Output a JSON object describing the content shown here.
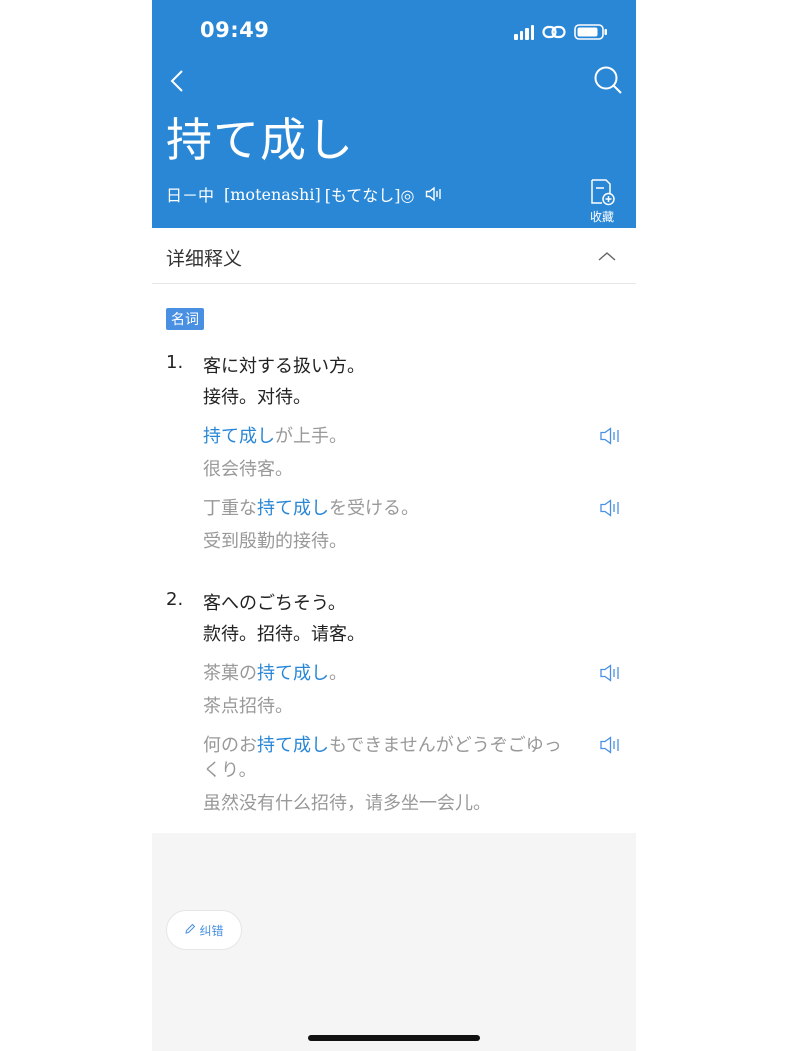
{
  "status_bar": {
    "time": "09:49"
  },
  "header": {
    "word": "持て成し",
    "direction": "日－中",
    "romaji": "[motenashi]",
    "kana": "[もてなし]◎",
    "favorite_label": "收藏",
    "accent_color": "#2a87d6"
  },
  "section": {
    "title": "详细释义"
  },
  "part_of_speech": "名词",
  "senses": [
    {
      "num": "1.",
      "def_ja": "客に対する扱い方。",
      "def_zh": "接待。对待。",
      "examples": [
        {
          "pre": "",
          "hl": "持て成し",
          "post": "が上手。",
          "zh": "很会待客。"
        },
        {
          "pre": "丁重な",
          "hl": "持て成し",
          "post": "を受ける。",
          "zh": "受到殷勤的接待。"
        }
      ]
    },
    {
      "num": "2.",
      "def_ja": "客へのごちそう。",
      "def_zh": "款待。招待。请客。",
      "examples": [
        {
          "pre": "茶菓の",
          "hl": "持て成し",
          "post": "。",
          "zh": "茶点招待。"
        },
        {
          "pre": "何のお",
          "hl": "持て成し",
          "post": "もできませんがどうぞごゆっくり。",
          "zh": "虽然没有什么招待，请多坐一会儿。"
        }
      ]
    }
  ],
  "report_label": "纠错"
}
